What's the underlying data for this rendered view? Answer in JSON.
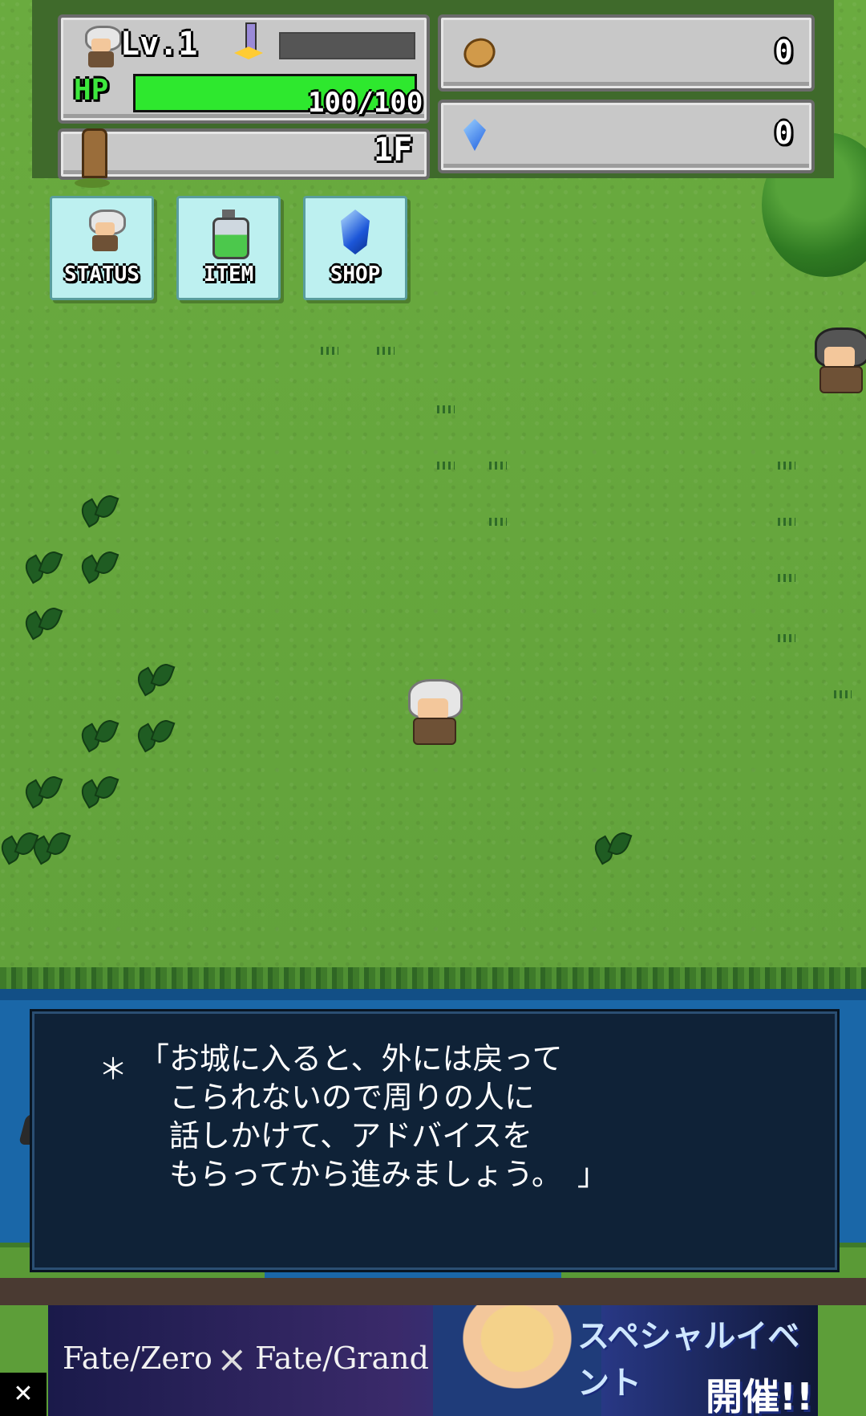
{
  "hud": {
    "level_label": "Lv.1",
    "hp_label": "HP",
    "hp_text": "100/100",
    "hp_fraction": 1.0,
    "exp_fraction": 0.0,
    "floor_label": "1F",
    "coins": "0",
    "gems": "0"
  },
  "menu": {
    "status_label": "STATUS",
    "item_label": "ITEM",
    "shop_label": "SHOP"
  },
  "dialog": {
    "prefix": "＊",
    "text": "「お城に入ると、外には戻って\n　こられないので周りの人に\n　話しかけて、アドバイスを\n　もらってから進みましょう。　」"
  },
  "ad": {
    "fate_zero": "Fate/Zero",
    "cross": "×",
    "fate_go": "Fate/Grand Order",
    "title": "スペシャルイベント",
    "subtitle": "開催!!",
    "close": "✕"
  },
  "colors": {
    "grass": "#6aab3f",
    "water": "#1a67a8",
    "hp_green": "#2ee82e",
    "menu_bg": "#bdf0f0",
    "dialog_bg": "#0f2237"
  },
  "icons": [
    "avatar-icon",
    "sword-icon",
    "coin-icon",
    "gem-icon",
    "pillar-icon",
    "potion-icon"
  ]
}
